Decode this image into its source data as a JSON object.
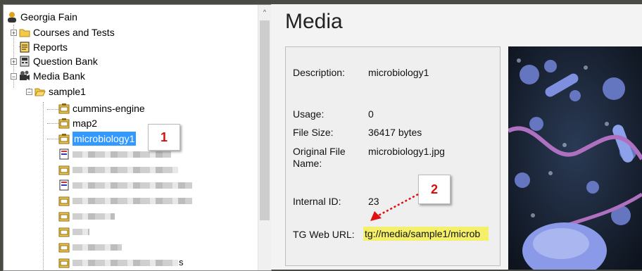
{
  "tree": {
    "root": {
      "label": "Georgia Fain"
    },
    "items": [
      {
        "label": "Courses and Tests"
      },
      {
        "label": "Reports"
      },
      {
        "label": "Question Bank"
      },
      {
        "label": "Media Bank"
      },
      {
        "label": "sample1"
      },
      {
        "label": "cummins-engine"
      },
      {
        "label": "map2"
      },
      {
        "label": "microbiology1"
      }
    ],
    "tail_fragment": "s"
  },
  "callouts": {
    "first": "1",
    "second": "2"
  },
  "media": {
    "title": "Media",
    "fields": {
      "description_label": "Description:",
      "description_value": "microbiology1",
      "usage_label": "Usage:",
      "usage_value": "0",
      "file_size_label": "File Size:",
      "file_size_value": "36417 bytes",
      "original_name_label": "Original File Name:",
      "original_name_value": "microbiology1.jpg",
      "internal_id_label": "Internal ID:",
      "internal_id_value": "23",
      "web_url_label": "TG Web URL:",
      "web_url_value": "tg://media/sample1/microb"
    }
  },
  "colors": {
    "selection": "#3399ff",
    "url_highlight": "#f4f06a",
    "callout_text": "#d01010",
    "arrow": "#e01010"
  }
}
